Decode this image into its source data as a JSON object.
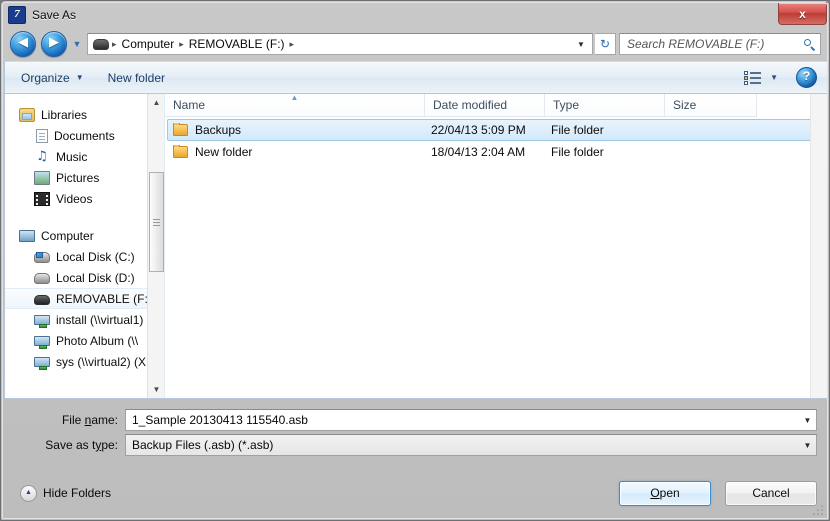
{
  "window": {
    "title": "Save As",
    "icon": "app-icon",
    "close_label": "x"
  },
  "navigation": {
    "back_label": "◀",
    "forward_label": "▶",
    "history_caret": "▼",
    "refresh_label": "↻",
    "address": {
      "drive_icon": "removable-drive-icon",
      "separator": "▸",
      "crumbs": [
        "Computer",
        "REMOVABLE (F:)"
      ],
      "dropdown_caret": "▼"
    },
    "search": {
      "placeholder": "Search REMOVABLE (F:)",
      "icon": "search-icon"
    }
  },
  "toolbar": {
    "organize_label": "Organize",
    "organize_caret": "▼",
    "new_folder_label": "New folder",
    "view_caret": "▼",
    "help_label": "?"
  },
  "sidebar": {
    "groups": [
      {
        "name": "Libraries",
        "icon": "libraries-icon",
        "items": [
          {
            "label": "Documents",
            "icon": "documents-icon"
          },
          {
            "label": "Music",
            "icon": "music-icon"
          },
          {
            "label": "Pictures",
            "icon": "pictures-icon"
          },
          {
            "label": "Videos",
            "icon": "videos-icon"
          }
        ]
      },
      {
        "name": "Computer",
        "icon": "computer-icon",
        "items": [
          {
            "label": "Local Disk (C:)",
            "icon": "local-disk-system-icon"
          },
          {
            "label": "Local Disk (D:)",
            "icon": "local-disk-icon"
          },
          {
            "label": "REMOVABLE (F:)",
            "icon": "removable-drive-icon",
            "selected": true
          },
          {
            "label": "install (\\\\virtual1)",
            "icon": "network-drive-icon"
          },
          {
            "label": "Photo Album (\\\\",
            "icon": "network-drive-icon"
          },
          {
            "label": "sys (\\\\virtual2) (X",
            "icon": "network-drive-icon"
          }
        ]
      }
    ],
    "scroll_up": "▲",
    "scroll_down": "▼"
  },
  "filelist": {
    "columns": [
      {
        "label": "Name",
        "sorted": "asc",
        "sort_glyph": "▲"
      },
      {
        "label": "Date modified"
      },
      {
        "label": "Type"
      },
      {
        "label": "Size"
      }
    ],
    "rows": [
      {
        "name": "Backups",
        "date_modified": "22/04/13 5:09 PM",
        "type": "File folder",
        "size": "",
        "icon": "folder-icon",
        "selected": true
      },
      {
        "name": "New folder",
        "date_modified": "18/04/13 2:04 AM",
        "type": "File folder",
        "size": "",
        "icon": "folder-icon",
        "selected": false
      }
    ]
  },
  "form": {
    "file_name": {
      "label_pre": "File ",
      "label_key": "n",
      "label_post": "ame:",
      "value": "1_Sample 20130413 115540.asb",
      "caret": "▼"
    },
    "save_as_type": {
      "label_pre": "Save as t",
      "label_key": "y",
      "label_post": "pe:",
      "value": "Backup Files (.asb) (*.asb)",
      "caret": "▼"
    }
  },
  "footer": {
    "hide_folders_label": "Hide Folders",
    "hide_folders_glyph": "▲",
    "open_pre": "",
    "open_key": "O",
    "open_post": "pen",
    "cancel_label": "Cancel"
  },
  "colors": {
    "accent": "#3c8ccc",
    "selection": "#d3e9fb",
    "titlebar": "#c4c4c4",
    "close_red": "#d4504a"
  }
}
